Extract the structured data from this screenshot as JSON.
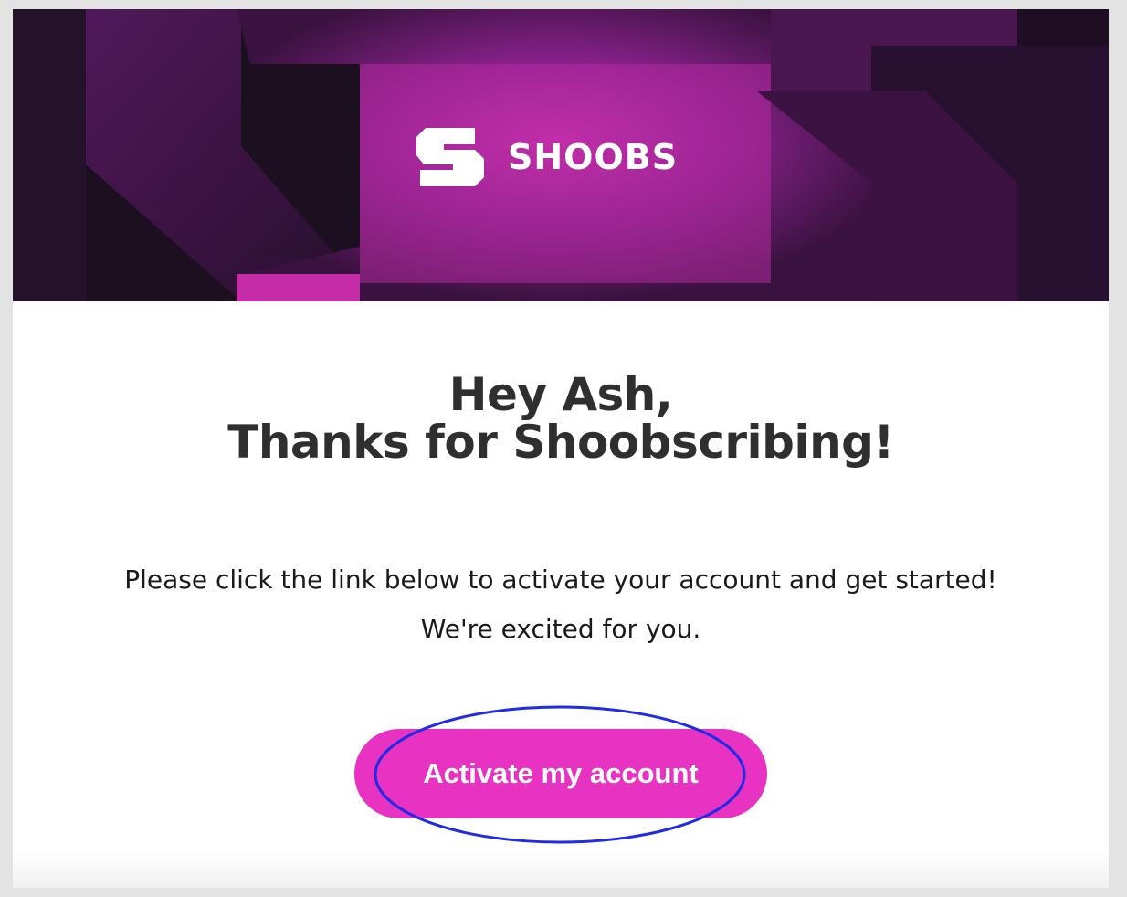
{
  "banner": {
    "logo_icon": "shoobs-s-logo-icon",
    "brand_name": "SHOOBS",
    "colors": {
      "dark": "#1b0f20",
      "purple": "#6b1a73",
      "magenta": "#c42ca8"
    }
  },
  "email": {
    "greeting": "Hey Ash,",
    "headline": "Thanks for Shoobscribing!",
    "body_line_1": "Please click the link below to activate your account and get started!",
    "body_line_2": "We're excited for you."
  },
  "cta": {
    "label": "Activate my account",
    "color": "#e832c2"
  },
  "annotation": {
    "color": "#1f2be6"
  }
}
